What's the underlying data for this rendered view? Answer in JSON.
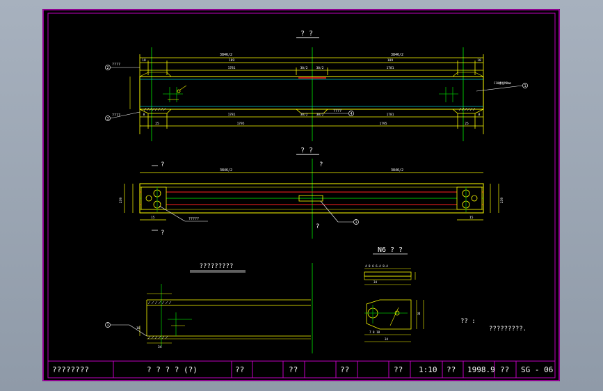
{
  "drawing": {
    "view_titles": {
      "front": "? ?",
      "top": "? ?",
      "section": "?????????",
      "detail": "N6 ? ?"
    },
    "section_marks": {
      "top_left": "?",
      "bottom_left": "?",
      "top_center": "?",
      "bottom_center": "?"
    },
    "dims": {
      "total_left": "3846/2",
      "total_right": "3846/2",
      "seg_a": "18",
      "seg_b": "189",
      "seg_c": "1781",
      "seg_d": "30/2",
      "seg_e": "30/2",
      "seg_f": "1781",
      "seg_g": "189",
      "seg_h": "18",
      "bot_a": "25",
      "bot_b": "1795",
      "bot_c": "1795",
      "bot_d": "25",
      "bot_mid_l": "30/2",
      "bot_mid_r": "30/2",
      "bot_seg_l": "8",
      "bot_seg_r": "8",
      "bot_1781_l": "1781",
      "bot_1781_r": "1781",
      "top_total_l": "3846/2",
      "top_total_r": "3846/2",
      "top_side_l": "15",
      "top_side_r": "15",
      "height_l": "239",
      "height_r": "239",
      "sec_w": "34",
      "sec_h": "18",
      "det_top": "4  8  6  6.4 8.4",
      "det_w": "34",
      "det_bot": "7  8  18",
      "det_h": "18"
    },
    "notes": {
      "n1": "????",
      "n2": "????",
      "n3": "????",
      "n4": "?????",
      "leader_right": "C10螺栓M8mm",
      "remark_label": "?? :",
      "remark_text": "?????????."
    },
    "markers": {
      "circle_1": "1",
      "circle_2": "2",
      "circle_3": "3",
      "circle_4": "4"
    }
  },
  "title_block": {
    "name": "????????",
    "title": "? ? ? ? (?)",
    "c1": "??",
    "c2": "??",
    "c3": "??",
    "c4": "??",
    "scale": "1:10",
    "c5": "??",
    "date": "1998.9",
    "c6": "??",
    "sheet_no": "SG - 06"
  },
  "colors": {
    "frame": "#c000c0",
    "geometry": "#ffff00",
    "centerline": "#00c000",
    "hidden_red": "#ff2020",
    "cyan": "#00c8c8",
    "text": "#ffffff"
  }
}
